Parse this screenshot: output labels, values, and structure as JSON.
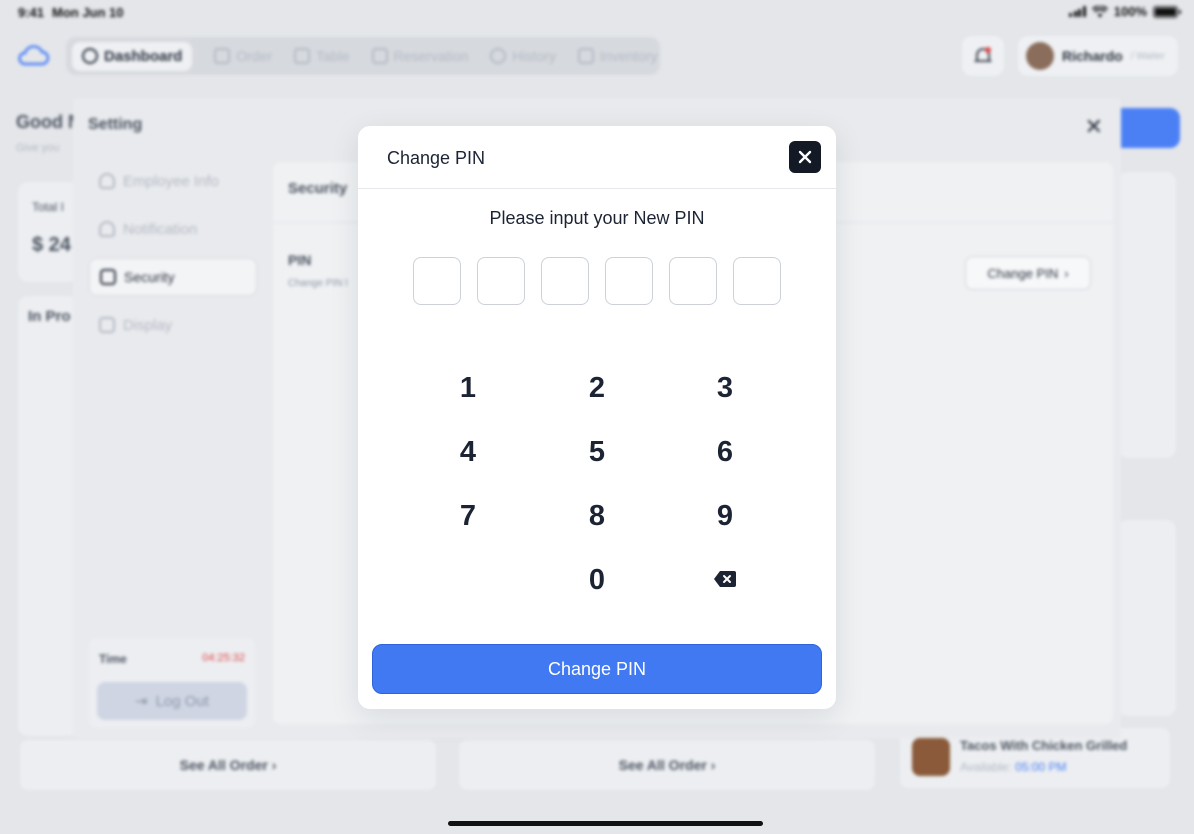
{
  "status_bar": {
    "time": "9:41",
    "date": "Mon Jun 10",
    "battery": "100%"
  },
  "nav": {
    "items": [
      {
        "label": "Dashboard",
        "active": true
      },
      {
        "label": "Order"
      },
      {
        "label": "Table"
      },
      {
        "label": "Reservation"
      },
      {
        "label": "History"
      },
      {
        "label": "Inventory"
      }
    ]
  },
  "user": {
    "name": "Richardo",
    "role": "/ Waiter"
  },
  "background": {
    "greeting": "Good M",
    "greeting_sub": "Give you",
    "total_label": "Total I",
    "total_value": "$ 24",
    "in_progress": "In Pro",
    "see_all_order": "See All Order",
    "food_name": "Tacos With Chicken Grilled",
    "food_available_label": "Available:",
    "food_available_time": "05:00 PM"
  },
  "settings": {
    "title": "Setting",
    "sidebar": [
      {
        "label": "Employee Info",
        "icon": "user-icon"
      },
      {
        "label": "Notification",
        "icon": "bell-icon"
      },
      {
        "label": "Security",
        "icon": "lock-icon",
        "active": true
      },
      {
        "label": "Display",
        "icon": "image-icon"
      }
    ],
    "time_label": "Time",
    "time_value": "04:25:32",
    "logout_label": "Log Out",
    "section_title": "Security",
    "pin_title": "PIN",
    "pin_sub": "Change PIN l",
    "change_pin_button": "Change PIN"
  },
  "dialog": {
    "title": "Change PIN",
    "prompt": "Please input your New PIN",
    "pin_length": 6,
    "keys": [
      "1",
      "2",
      "3",
      "4",
      "5",
      "6",
      "7",
      "8",
      "9",
      "0"
    ],
    "submit_label": "Change PIN"
  },
  "colors": {
    "primary": "#4179f2",
    "dark": "#131a26",
    "alert": "#e04848"
  }
}
